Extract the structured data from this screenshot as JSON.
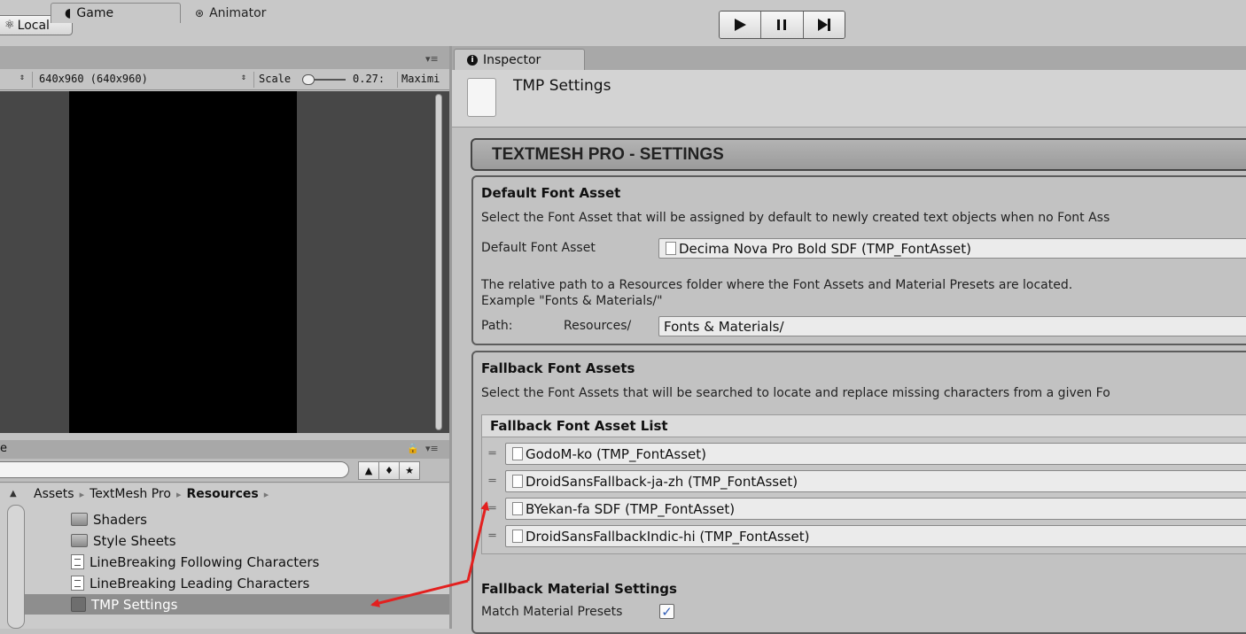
{
  "toolbar": {
    "local_label": "Local",
    "play_icon": "play-icon",
    "pause_icon": "pause-icon",
    "step_icon": "step-icon"
  },
  "game_panel": {
    "tabs": [
      {
        "label": "Game",
        "icon": "pacman-game-icon"
      },
      {
        "label": "Animator",
        "icon": "animator-icon"
      }
    ],
    "resolution": "640x960 (640x960)",
    "scale_label": "Scale",
    "scale_value": "0.27:",
    "maximize_label": "Maximi"
  },
  "project_panel": {
    "title_fragment": "e",
    "breadcrumb": [
      "Assets",
      "TextMesh Pro",
      "Resources"
    ],
    "items": [
      {
        "name": "Shaders",
        "type": "folder"
      },
      {
        "name": "Style Sheets",
        "type": "folder"
      },
      {
        "name": "LineBreaking Following Characters",
        "type": "text"
      },
      {
        "name": "LineBreaking Leading Characters",
        "type": "text"
      },
      {
        "name": "TMP Settings",
        "type": "settings",
        "selected": true
      }
    ]
  },
  "inspector": {
    "tab_label": "Inspector",
    "title": "TMP Settings",
    "banner": "TEXTMESH PRO - SETTINGS",
    "default_font": {
      "header": "Default Font Asset",
      "description": "Select the Font Asset that will be assigned by default to newly created text objects when no Font Ass",
      "field_label": "Default Font Asset",
      "field_value": "Decima Nova Pro Bold SDF (TMP_FontAsset)",
      "path_description": "The relative path to a Resources folder where the Font Assets and Material Presets are located.",
      "path_example": "Example \"Fonts & Materials/\"",
      "path_label": "Path:",
      "path_prefix": "Resources/",
      "path_value": "Fonts & Materials/"
    },
    "fallback": {
      "header": "Fallback Font Assets",
      "description": "Select the Font Assets that will be searched to locate and replace missing characters from a given Fo",
      "list_header": "Fallback Font Asset List",
      "items": [
        "GodoM-ko (TMP_FontAsset)",
        "DroidSansFallback-ja-zh (TMP_FontAsset)",
        "BYekan-fa SDF (TMP_FontAsset)",
        "DroidSansFallbackIndic-hi (TMP_FontAsset)"
      ],
      "material_header": "Fallback Material Settings",
      "match_label": "Match Material Presets",
      "match_checked": "✓"
    }
  },
  "colors": {
    "annotation_arrow": "#e3201f",
    "selected_row": "#8e8e8e",
    "checkbox": "#3560b8"
  }
}
